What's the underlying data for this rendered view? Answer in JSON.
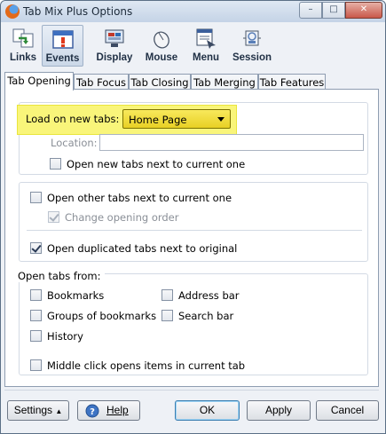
{
  "window": {
    "title": "Tab Mix Plus Options"
  },
  "toolbar": {
    "items": [
      {
        "label": "Links",
        "icon": "links-icon"
      },
      {
        "label": "Events",
        "icon": "events-icon",
        "selected": true
      },
      {
        "label": "Display",
        "icon": "display-icon"
      },
      {
        "label": "Mouse",
        "icon": "mouse-icon"
      },
      {
        "label": "Menu",
        "icon": "menu-icon"
      },
      {
        "label": "Session",
        "icon": "session-icon"
      }
    ]
  },
  "tabs": [
    {
      "label": "Tab Opening",
      "selected": true
    },
    {
      "label": "Tab Focus"
    },
    {
      "label": "Tab Closing"
    },
    {
      "label": "Tab Merging"
    },
    {
      "label": "Tab Features"
    }
  ],
  "load_new_tabs": {
    "label": "Load on new tabs:",
    "value": "Home Page",
    "location_label": "Location:",
    "location_value": "",
    "open_next_label": "Open new tabs next to current one",
    "open_next_checked": false
  },
  "other_tabs": {
    "open_other_label": "Open other tabs next to current one",
    "open_other_checked": false,
    "change_order_label": "Change opening order",
    "change_order_checked": true,
    "change_order_disabled": true,
    "open_duplicated_label": "Open duplicated tabs next to original",
    "open_duplicated_checked": true
  },
  "open_tabs_from": {
    "title": "Open tabs from:",
    "bookmarks": "Bookmarks",
    "address_bar": "Address bar",
    "groups_of_bookmarks": "Groups of bookmarks",
    "search_bar": "Search bar",
    "history": "History",
    "middle_click": "Middle click opens items in current tab"
  },
  "buttons": {
    "settings": "Settings",
    "help": "Help",
    "ok": "OK",
    "apply": "Apply",
    "cancel": "Cancel"
  },
  "colors": {
    "highlight": "#f9f57a",
    "select_bg": "#e8d024"
  }
}
